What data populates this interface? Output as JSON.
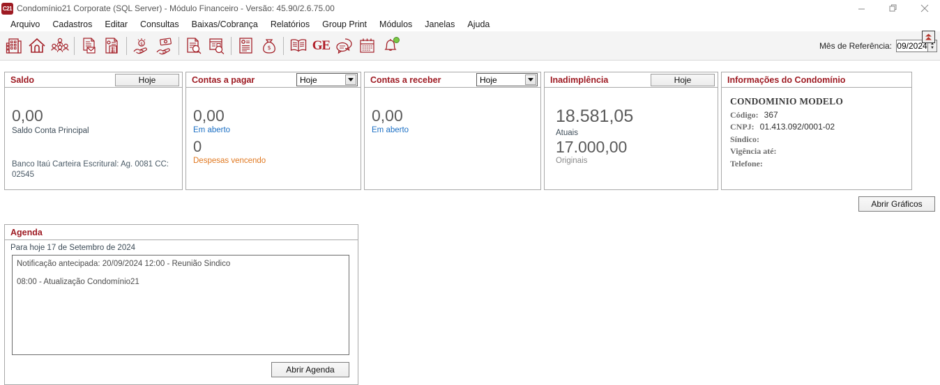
{
  "window": {
    "app_icon_label": "C21",
    "title": "Condomínio21 Corporate  (SQL Server)  - Módulo Financeiro - Versão: 45.90/2.6.75.00",
    "minimize_label": "Minimizar",
    "restore_label": "Restaurar",
    "close_label": "Fechar"
  },
  "menubar": {
    "items": [
      {
        "label": "Arquivo"
      },
      {
        "label": "Cadastros"
      },
      {
        "label": "Editar"
      },
      {
        "label": "Consultas"
      },
      {
        "label": "Baixas/Cobrança"
      },
      {
        "label": "Relatórios"
      },
      {
        "label": "Group Print"
      },
      {
        "label": "Módulos"
      },
      {
        "label": "Janelas"
      },
      {
        "label": "Ajuda"
      }
    ]
  },
  "toolbar": {
    "icons": [
      {
        "name": "building-icon"
      },
      {
        "name": "home-icon"
      },
      {
        "name": "people-group-icon"
      },
      {
        "name": "separator"
      },
      {
        "name": "document-mail-icon"
      },
      {
        "name": "document-calculator-icon"
      },
      {
        "name": "separator"
      },
      {
        "name": "hand-coin-icon"
      },
      {
        "name": "hand-money-icon"
      },
      {
        "name": "separator"
      },
      {
        "name": "document-search-icon"
      },
      {
        "name": "screen-search-icon"
      },
      {
        "name": "separator"
      },
      {
        "name": "document-list-icon"
      },
      {
        "name": "money-bag-icon"
      },
      {
        "name": "separator"
      },
      {
        "name": "book-icon"
      },
      {
        "name": "ge-logo-icon"
      },
      {
        "name": "chat-bubbles-icon"
      },
      {
        "name": "calendar-icon"
      },
      {
        "name": "bell-notification-icon"
      }
    ],
    "ge_logo_text": "GE",
    "reference_month_label": "Mês de Referência:",
    "reference_month_value": "09/2024",
    "collapse_button_label": "Recolher"
  },
  "panels": {
    "saldo": {
      "title": "Saldo",
      "filter_label": "Hoje",
      "value": "0,00",
      "value_label": "Saldo Conta Principal",
      "account_info": "Banco Itaú Carteira Escritural: Ag. 0081 CC: 02545"
    },
    "contas_pagar": {
      "title": "Contas a pagar",
      "filter_label": "Hoje",
      "value": "0,00",
      "value_label": "Em aberto",
      "secondary_value": "0",
      "secondary_label": "Despesas vencendo"
    },
    "contas_receber": {
      "title": "Contas a receber",
      "filter_label": "Hoje",
      "value": "0,00",
      "value_label": "Em aberto"
    },
    "inadimplencia": {
      "title": "Inadimplência",
      "filter_label": "Hoje",
      "value": "18.581,05",
      "value_label": "Atuais",
      "secondary_value": "17.000,00",
      "secondary_label": "Originais"
    },
    "informacoes": {
      "title": "Informações do Condomínio",
      "condo_name": "CONDOMINIO MODELO",
      "rows": [
        {
          "key": "Código:",
          "value": "367"
        },
        {
          "key": "CNPJ:",
          "value": "01.413.092/0001-02"
        },
        {
          "key": "Síndico:",
          "value": ""
        },
        {
          "key": "Vigência até:",
          "value": ""
        },
        {
          "key": "Telefone:",
          "value": ""
        }
      ]
    }
  },
  "charts_button": {
    "label": "Abrir Gráficos"
  },
  "agenda": {
    "title": "Agenda",
    "today_label": "Para hoje 17 de Setembro de 2024",
    "entries": [
      "Notificação antecipada: 20/09/2024 12:00 - Reunião Sindico",
      "08:00 - Atualização Condomínio21"
    ],
    "open_button_label": "Abrir Agenda"
  },
  "colors": {
    "brand_red": "#9e1b23",
    "icon_red": "#a32028",
    "link_blue": "#1b6fc4",
    "warn_orange": "#e07820",
    "value_gray": "#5a5a5a",
    "toolbar_bg": "#f4f4f4"
  }
}
